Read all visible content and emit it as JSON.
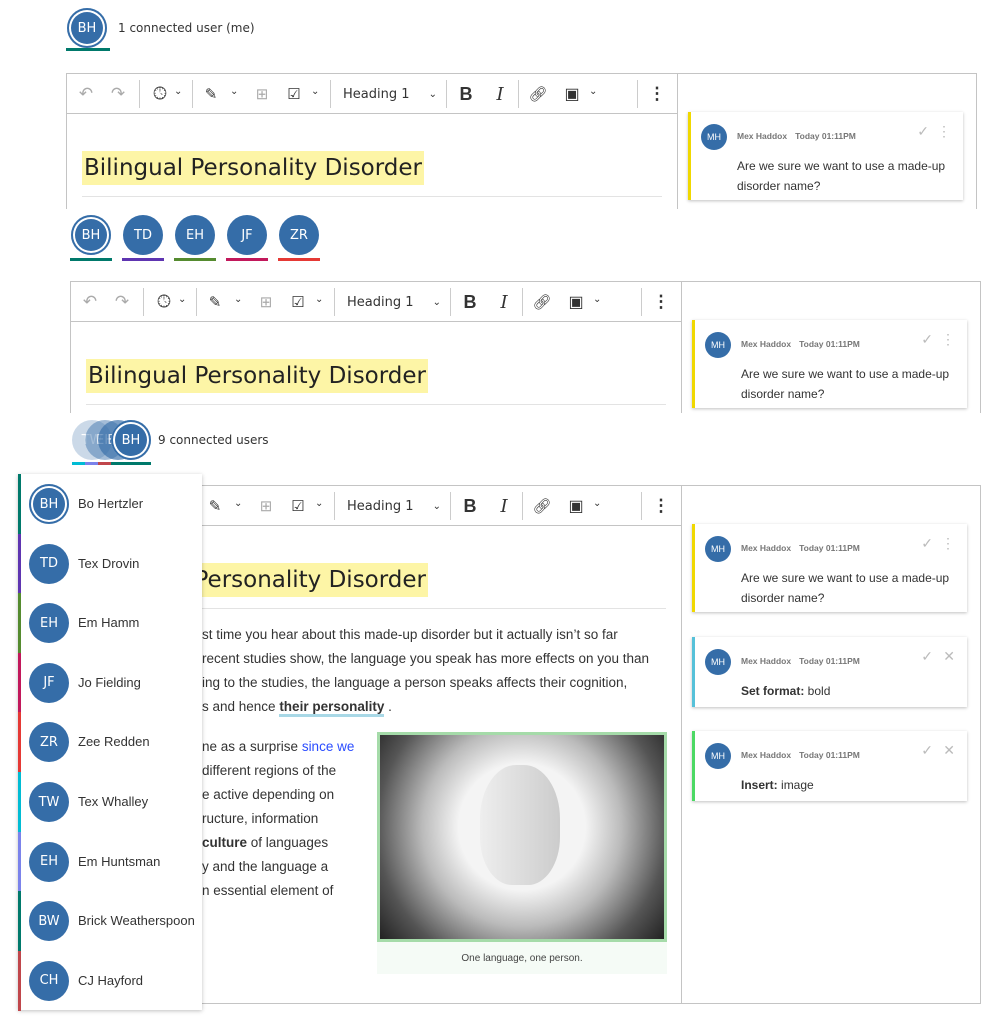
{
  "section1": {
    "avatar": {
      "initials": "BH",
      "color": "#00796b"
    },
    "users_text": "1 connected user (me)"
  },
  "section2": {
    "avatars": [
      {
        "initials": "BH",
        "color": "#00796b"
      },
      {
        "initials": "TD",
        "color": "#5e35b1"
      },
      {
        "initials": "EH",
        "color": "#558b2f"
      },
      {
        "initials": "JF",
        "color": "#c2185b"
      },
      {
        "initials": "ZR",
        "color": "#e53935"
      }
    ]
  },
  "section3": {
    "stack_initials": [
      "TW",
      "EH",
      "BW",
      "BH"
    ],
    "users_text": "9 connected users",
    "users": [
      {
        "initials": "BH",
        "name": "Bo Hertzler",
        "color": "#00796b"
      },
      {
        "initials": "TD",
        "name": "Tex Drovin",
        "color": "#5e35b1"
      },
      {
        "initials": "EH",
        "name": "Em Hamm",
        "color": "#558b2f"
      },
      {
        "initials": "JF",
        "name": "Jo Fielding",
        "color": "#c2185b"
      },
      {
        "initials": "ZR",
        "name": "Zee Redden",
        "color": "#e53935"
      },
      {
        "initials": "TW",
        "name": "Tex Whalley",
        "color": "#00bcd4"
      },
      {
        "initials": "EH",
        "name": "Em Huntsman",
        "color": "#7b83eb"
      },
      {
        "initials": "BW",
        "name": "Brick Weatherspoon",
        "color": "#00796b"
      },
      {
        "initials": "CH",
        "name": "CJ Hayford",
        "color": "#c0464b"
      }
    ],
    "paragraph1": [
      "st time you hear about this made-up disorder but it actually isn’t so far",
      "recent studies show, the language you speak has more effects on you than",
      "ing to the studies, the language a person speaks affects their cognition,"
    ],
    "paragraph1_last_pre": "s and hence ",
    "paragraph1_last_tracked": "their personality",
    "paragraph1_last_post": " .",
    "paragraph2_first_pre": "ne as a surprise ",
    "paragraph2_first_link": "since we",
    "paragraph2": [
      "different regions of the",
      "e active depending on",
      "ructure, information"
    ],
    "paragraph2_culture_bold": "culture",
    "paragraph2_culture_rest": " of languages",
    "paragraph2_tail": [
      "y and the language a",
      "n essential element of"
    ],
    "image_caption": "One language, one person.",
    "image_border": "#a5dba9"
  },
  "toolbar": {
    "heading": "Heading 1",
    "bold": "B",
    "italic": "I"
  },
  "document": {
    "title": "Bilingual Personality Disorder"
  },
  "comments": [
    {
      "initials": "MH",
      "author": "Mex Haddox",
      "time": "Today 01:11PM",
      "text": "Are we sure we want to use a made-up disorder name?",
      "color": "#f0d800"
    },
    {
      "initials": "MH",
      "author": "Mex Haddox",
      "time": "Today 01:11PM",
      "label": "Set format:",
      "value": " bold",
      "color": "#56c1d9"
    },
    {
      "initials": "MH",
      "author": "Mex Haddox",
      "time": "Today 01:11PM",
      "label": "Insert:",
      "value": " image",
      "color": "#4cd964"
    }
  ]
}
